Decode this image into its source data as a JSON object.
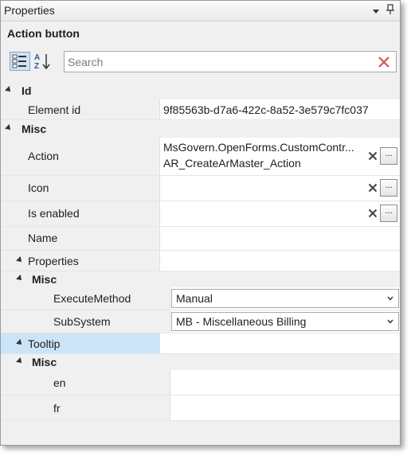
{
  "panel": {
    "title": "Properties",
    "object_name": "Action button",
    "search": {
      "placeholder": "Search",
      "value": ""
    }
  },
  "grid": {
    "cat_id": "Id",
    "element_id": {
      "name": "Element id",
      "value": "9f85563b-d7a6-422c-8a52-3e579c7fc037"
    },
    "cat_misc": "Misc",
    "action": {
      "name": "Action",
      "value_line1": "MsGovern.OpenForms.CustomContr...",
      "value_line2": "AR_CreateArMaster_Action",
      "button": "..."
    },
    "icon": {
      "name": "Icon",
      "value": "",
      "button": "..."
    },
    "is_enabled": {
      "name": "Is enabled",
      "value": "",
      "button": "..."
    },
    "name": {
      "name": "Name",
      "value": ""
    },
    "properties": {
      "name": "Properties"
    },
    "properties_misc": "Misc",
    "execute_method": {
      "name": "ExecuteMethod",
      "value": "Manual"
    },
    "subsystem": {
      "name": "SubSystem",
      "value": "MB - Miscellaneous  Billing"
    },
    "tooltip": {
      "name": "Tooltip"
    },
    "tooltip_misc": "Misc",
    "en": {
      "name": "en",
      "value": ""
    },
    "fr": {
      "name": "fr",
      "value": ""
    }
  },
  "icons": {
    "categorized": "categorized-view-icon",
    "alphabetical": "sort-alphabetical-icon",
    "clear": "clear-search-icon",
    "pin": "pin-icon",
    "dropdown": "panel-dropdown-icon",
    "reset": "reset-value-icon"
  }
}
